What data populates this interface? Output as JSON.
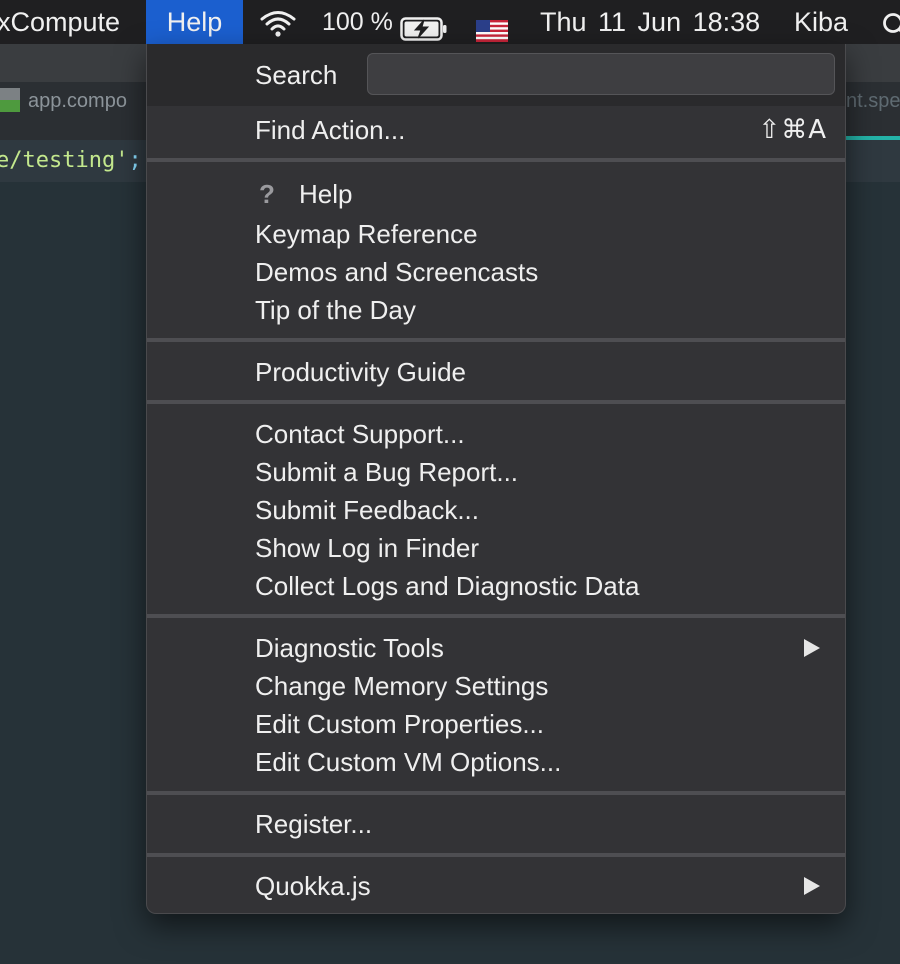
{
  "menubar": {
    "app_name": "xCompute",
    "help_label": "Help",
    "battery_percent": "100 %",
    "datetime": "Thu 11 Jun  18:38",
    "user": "Kiba",
    "icons": [
      "wifi-icon",
      "battery-charging-icon",
      "us-flag-icon",
      "spotlight-search-icon"
    ]
  },
  "editor": {
    "tab_left": "app.compo",
    "tab_right": "nt.spe",
    "code_line": {
      "string": "e/testing'",
      "punct": ";"
    },
    "accent_color": "#24b3a8"
  },
  "help_menu": {
    "search_label": "Search",
    "search_value": "",
    "find_action": {
      "label": "Find Action...",
      "shortcut": "⇧⌘A"
    },
    "group1": [
      "Help",
      "Keymap Reference",
      "Demos and Screencasts",
      "Tip of the Day"
    ],
    "group2": [
      "Productivity Guide"
    ],
    "group3": [
      "Contact Support...",
      "Submit a Bug Report...",
      "Submit Feedback...",
      "Show Log in Finder",
      "Collect Logs and Diagnostic Data"
    ],
    "group4": [
      "Diagnostic Tools",
      "Change Memory Settings",
      "Edit Custom Properties...",
      "Edit Custom VM Options..."
    ],
    "group5": [
      "Register..."
    ],
    "group6": [
      "Quokka.js"
    ],
    "help_icon_glyph": "?",
    "highlight_color": "#1b5fcf"
  }
}
